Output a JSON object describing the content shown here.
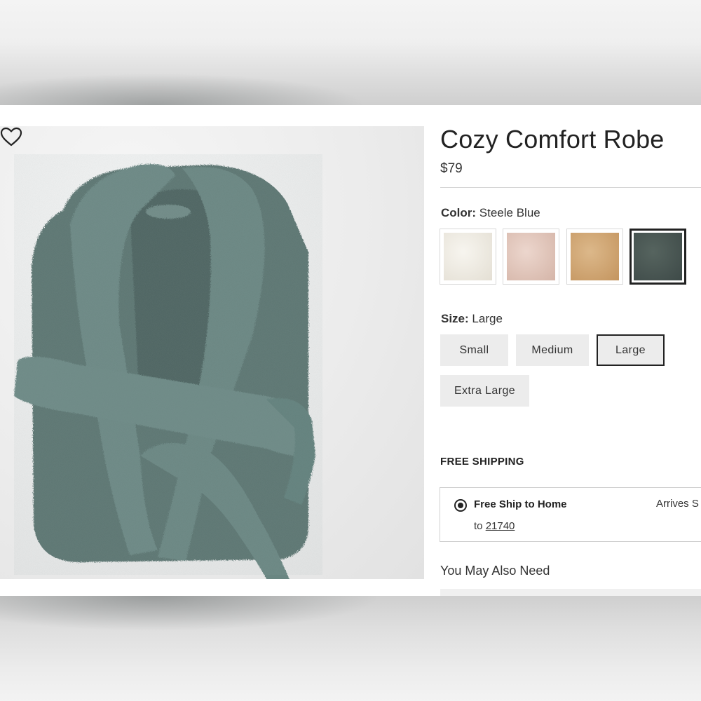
{
  "product": {
    "title": "Cozy Comfort Robe",
    "price": "$79"
  },
  "color": {
    "label": "Color:",
    "selected_value": "Steele Blue",
    "swatches": [
      {
        "name": "ivory",
        "hex": "#ece8df"
      },
      {
        "name": "blush",
        "hex": "#e3c7bd"
      },
      {
        "name": "camel",
        "hex": "#d2a978"
      },
      {
        "name": "steele-blue",
        "hex": "#4b5957",
        "selected": true
      }
    ]
  },
  "size": {
    "label": "Size:",
    "selected_value": "Large",
    "options": [
      "Small",
      "Medium",
      "Large",
      "Extra Large"
    ]
  },
  "shipping": {
    "heading": "FREE SHIPPING",
    "option_label": "Free Ship to Home",
    "to_prefix": "to",
    "zip": "21740",
    "arrives": "Arrives S"
  },
  "recommendations": {
    "heading": "You May Also Need"
  },
  "icons": {
    "favorite": "heart-icon"
  },
  "colors": {
    "robe": "#5f7a76",
    "text": "#222222",
    "button_bg": "#ececec"
  }
}
